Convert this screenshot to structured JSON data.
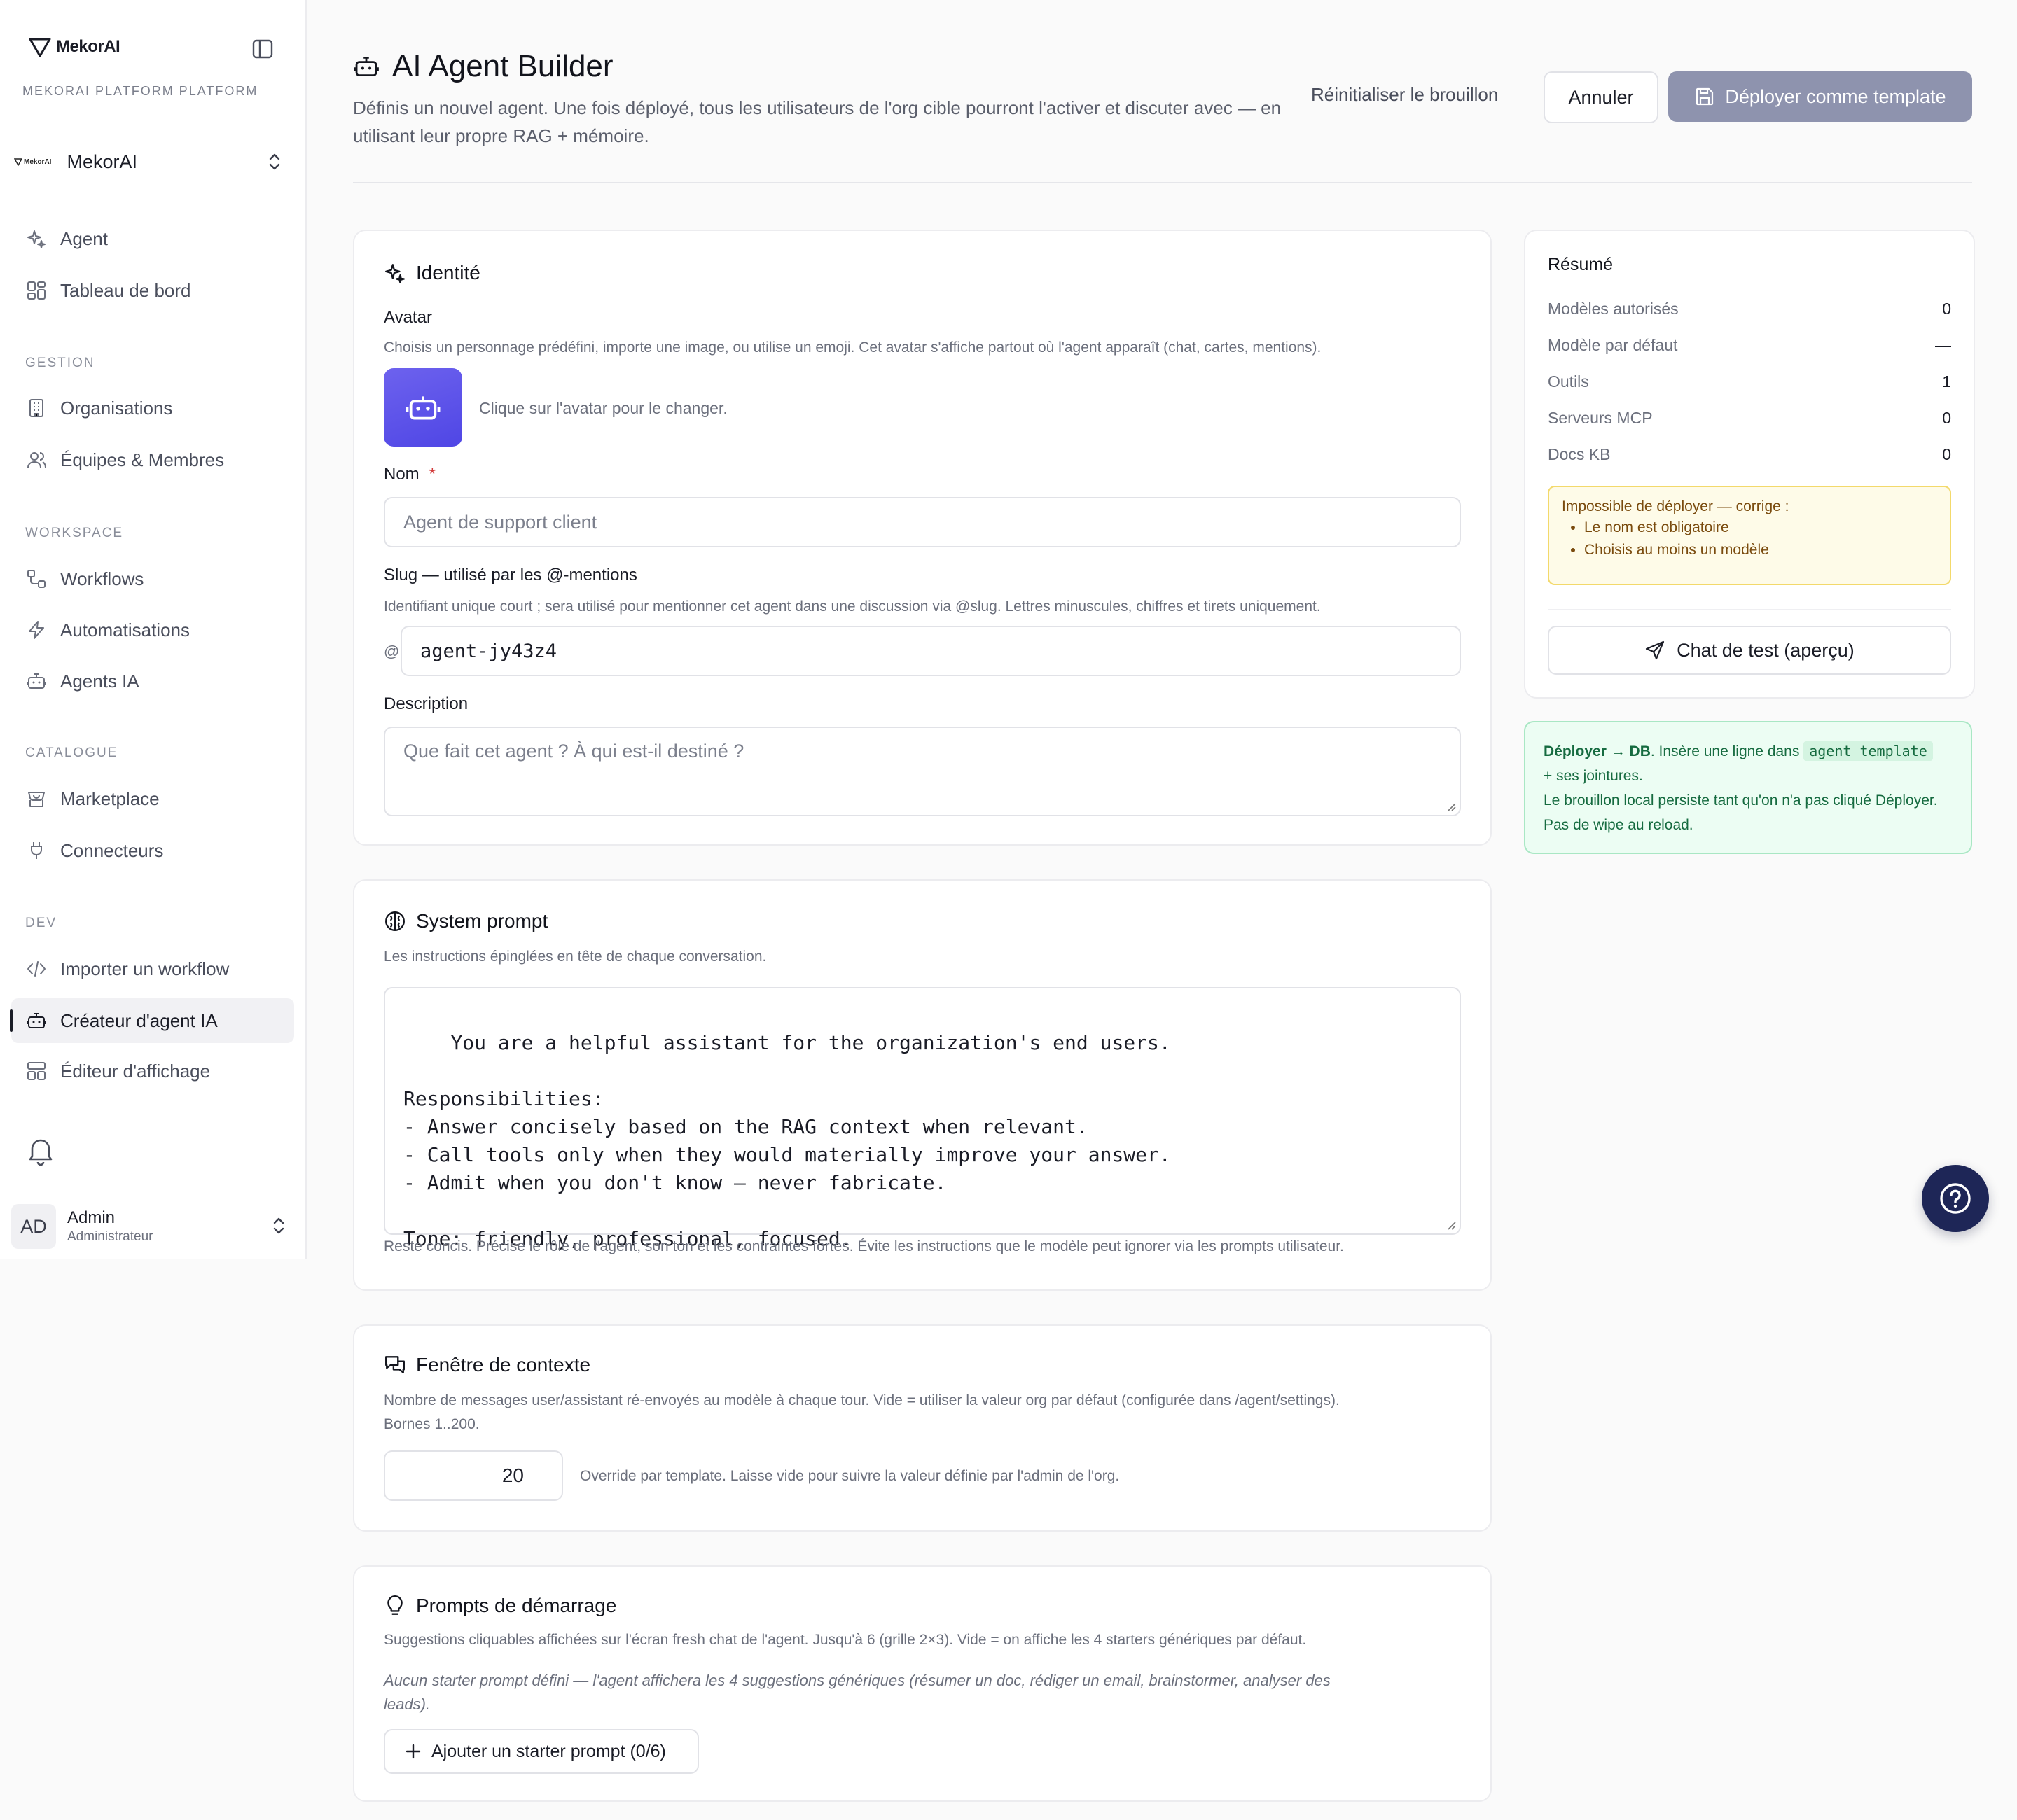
{
  "brand": {
    "name": "MekorAI",
    "platform_label": "MEKORAI PLATFORM PLATFORM"
  },
  "org": {
    "name": "MekorAI",
    "mini_logo": "MekorAI"
  },
  "sidebar": {
    "top_items": [
      {
        "label": "Agent",
        "icon": "sparkles-icon"
      },
      {
        "label": "Tableau de bord",
        "icon": "dashboard-icon"
      }
    ],
    "sections": [
      {
        "label": "GESTION",
        "items": [
          {
            "label": "Organisations",
            "icon": "building-icon"
          },
          {
            "label": "Équipes & Membres",
            "icon": "users-icon"
          }
        ]
      },
      {
        "label": "WORKSPACE",
        "items": [
          {
            "label": "Workflows",
            "icon": "workflow-icon"
          },
          {
            "label": "Automatisations",
            "icon": "zap-icon"
          },
          {
            "label": "Agents IA",
            "icon": "bot-icon"
          }
        ]
      },
      {
        "label": "CATALOGUE",
        "items": [
          {
            "label": "Marketplace",
            "icon": "store-icon"
          },
          {
            "label": "Connecteurs",
            "icon": "plug-icon"
          }
        ]
      },
      {
        "label": "DEV",
        "items": [
          {
            "label": "Importer un workflow",
            "icon": "code-icon"
          },
          {
            "label": "Créateur d'agent IA",
            "icon": "bot-icon",
            "active": true
          },
          {
            "label": "Éditeur d'affichage",
            "icon": "layout-icon"
          }
        ]
      }
    ],
    "user": {
      "initials": "AD",
      "name": "Admin",
      "role": "Administrateur"
    }
  },
  "header": {
    "title": "AI Agent Builder",
    "description": "Définis un nouvel agent. Une fois déployé, tous les utilisateurs de l'org cible pourront l'activer et discuter avec — en utilisant leur propre RAG + mémoire.",
    "reset_label": "Réinitialiser le brouillon",
    "cancel_label": "Annuler",
    "deploy_label": "Déployer comme template"
  },
  "identity": {
    "title": "Identité",
    "avatar_label": "Avatar",
    "avatar_help": "Choisis un personnage prédéfini, importe une image, ou utilise un emoji. Cet avatar s'affiche partout où l'agent apparaît (chat, cartes, mentions).",
    "avatar_hint": "Clique sur l'avatar pour le changer.",
    "name_label": "Nom",
    "name_required": "*",
    "name_placeholder": "Agent de support client",
    "slug_label": "Slug — utilisé par les @-mentions",
    "slug_help": "Identifiant unique court ; sera utilisé pour mentionner cet agent dans une discussion via @slug. Lettres minuscules, chiffres et tirets uniquement.",
    "slug_prefix": "@",
    "slug_value": "agent-jy43z4",
    "description_label": "Description",
    "description_placeholder": "Que fait cet agent ? À qui est-il destiné ?"
  },
  "system_prompt": {
    "title": "System prompt",
    "help": "Les instructions épinglées en tête de chaque conversation.",
    "value": "You are a helpful assistant for the organization's end users.\n\nResponsibilities:\n- Answer concisely based on the RAG context when relevant.\n- Call tools only when they would materially improve your answer.\n- Admit when you don't know — never fabricate.\n\nTone: friendly, professional, focused.",
    "footer_help": "Reste concis. Précise le rôle de l'agent, son ton et les contraintes fortes. Évite les instructions que le modèle peut ignorer via les prompts utilisateur."
  },
  "context_window": {
    "title": "Fenêtre de contexte",
    "help_line1": "Nombre de messages user/assistant ré-envoyés au modèle à chaque tour. Vide = utiliser la valeur org par défaut (configurée dans /agent/settings).",
    "help_line2": "Bornes 1..200.",
    "value": "20",
    "hint": "Override par template. Laisse vide pour suivre la valeur définie par l'admin de l'org."
  },
  "starters": {
    "title": "Prompts de démarrage",
    "help": "Suggestions cliquables affichées sur l'écran fresh chat de l'agent. Jusqu'à 6 (grille 2×3). Vide = on affiche les 4 starters génériques par défaut.",
    "empty_line1": "Aucun starter prompt défini — l'agent affichera les 4 suggestions génériques (résumer un doc, rédiger un email, brainstormer, analyser des",
    "empty_line2": "leads).",
    "add_label": "Ajouter un starter prompt (0/6)"
  },
  "summary": {
    "title": "Résumé",
    "rows": [
      {
        "label": "Modèles autorisés",
        "value": "0"
      },
      {
        "label": "Modèle par défaut",
        "value": "—"
      },
      {
        "label": "Outils",
        "value": "1"
      },
      {
        "label": "Serveurs MCP",
        "value": "0"
      },
      {
        "label": "Docs KB",
        "value": "0"
      }
    ],
    "warning_title": "Impossible de déployer — corrige :",
    "warnings": [
      "Le nom est obligatoire",
      "Choisis au moins un modèle"
    ],
    "test_chat_label": "Chat de test (aperçu)"
  },
  "deploy_info": {
    "bold": "Déployer → DB",
    "text1": ". Insère une ligne dans ",
    "code": "agent_template",
    "text2": "+ ses jointures.",
    "text3": "Le brouillon local persiste tant qu'on n'a pas cliqué Déployer.",
    "text4": "Pas de wipe au reload."
  },
  "colors": {
    "accent": "#4f46e5",
    "deploy_disabled": "#8e93ae",
    "warning_bg": "#fefbe8",
    "success_bg": "#ecfdf3",
    "fab": "#1e2657"
  }
}
